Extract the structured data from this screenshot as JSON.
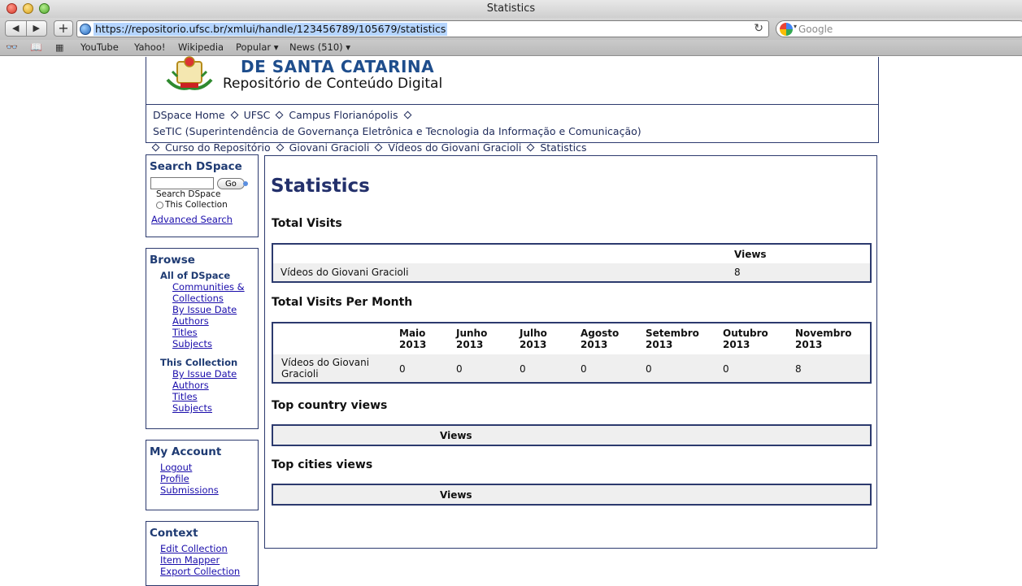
{
  "browser": {
    "window_title": "Statistics",
    "url": "https://repositorio.ufsc.br/xmlui/handle/123456789/105679/statistics",
    "search_placeholder": "Google",
    "bookmarks": [
      "YouTube",
      "Yahoo!",
      "Wikipedia",
      "Popular ▾",
      "News (510) ▾"
    ]
  },
  "header": {
    "university_line": "DE SANTA CATARINA",
    "repository_name": "Repositório de Conteúdo Digital"
  },
  "trail": {
    "line1": [
      "DSpace Home",
      "UFSC",
      "Campus Florianópolis",
      "SeTIC (Superintendência de Governança Eletrônica e Tecnologia da Informação e Comunicação)"
    ],
    "line2": [
      "Curso do Repositório",
      "Giovani Gracioli",
      "Vídeos do Giovani Gracioli",
      "Statistics"
    ]
  },
  "sidebar": {
    "search": {
      "title": "Search DSpace",
      "go_label": "Go",
      "scope_all": "Search DSpace",
      "scope_collection": "This Collection",
      "advanced": "Advanced Search"
    },
    "browse": {
      "title": "Browse",
      "all_heading": "All of DSpace",
      "all_links": [
        "Communities &",
        "Collections",
        "By Issue Date",
        "Authors",
        "Titles",
        "Subjects"
      ],
      "collection_heading": "This Collection",
      "collection_links": [
        "By Issue Date",
        "Authors",
        "Titles",
        "Subjects"
      ]
    },
    "account": {
      "title": "My Account",
      "links": [
        "Logout",
        "Profile",
        "Submissions"
      ]
    },
    "context": {
      "title": "Context",
      "links": [
        "Edit Collection",
        "Item Mapper",
        "Export Collection"
      ]
    }
  },
  "main": {
    "title": "Statistics",
    "total_visits": {
      "heading": "Total Visits",
      "col_header": "Views",
      "row_label": "Vídeos do Giovani Gracioli",
      "value": "8"
    },
    "per_month": {
      "heading": "Total Visits Per Month",
      "months": [
        {
          "name": "Maio",
          "year": "2013",
          "value": "0"
        },
        {
          "name": "Junho",
          "year": "2013",
          "value": "0"
        },
        {
          "name": "Julho",
          "year": "2013",
          "value": "0"
        },
        {
          "name": "Agosto",
          "year": "2013",
          "value": "0"
        },
        {
          "name": "Setembro",
          "year": "2013",
          "value": "0"
        },
        {
          "name": "Outubro",
          "year": "2013",
          "value": "0"
        },
        {
          "name": "Novembro",
          "year": "2013",
          "value": "8"
        }
      ],
      "row_label_1": "Vídeos do Giovani",
      "row_label_2": "Gracioli"
    },
    "country": {
      "heading": "Top country views",
      "col_header": "Views"
    },
    "cities": {
      "heading": "Top cities views",
      "col_header": "Views"
    }
  }
}
